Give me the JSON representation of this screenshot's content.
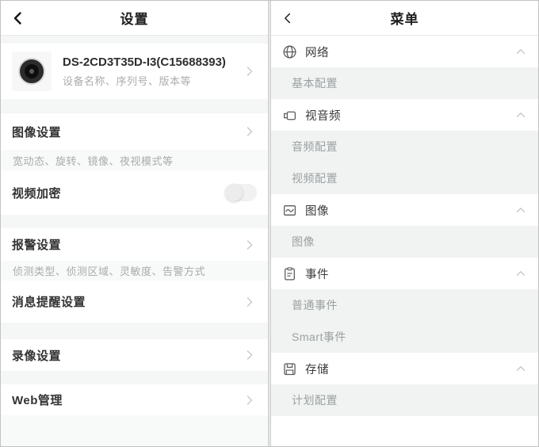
{
  "left": {
    "title": "设置",
    "device_name": "DS-2CD3T35D-I3(C15688393)",
    "device_desc": "设备名称、序列号、版本等",
    "items": [
      {
        "label": "图像设置",
        "desc": "宽动态、旋转、镜像、夜视模式等"
      },
      {
        "label": "视频加密",
        "toggle_state": "off"
      },
      {
        "label": "报警设置",
        "desc": "侦测类型、侦测区域、灵敏度、告警方式"
      },
      {
        "label": "消息提醒设置"
      },
      {
        "label": "录像设置"
      },
      {
        "label": "Web管理"
      }
    ]
  },
  "right": {
    "title": "菜单",
    "sections": [
      {
        "label": "网络",
        "icon": "globe-icon",
        "expanded": true,
        "children": [
          "基本配置"
        ]
      },
      {
        "label": "视音频",
        "icon": "camcorder-icon",
        "expanded": true,
        "children": [
          "音频配置",
          "视频配置"
        ]
      },
      {
        "label": "图像",
        "icon": "picture-icon",
        "expanded": true,
        "children": [
          "图像"
        ]
      },
      {
        "label": "事件",
        "icon": "clipboard-icon",
        "expanded": true,
        "children": [
          "普通事件",
          "Smart事件"
        ]
      },
      {
        "label": "存储",
        "icon": "floppy-icon",
        "expanded": true,
        "children": [
          "计划配置"
        ]
      }
    ]
  },
  "colors": {
    "title_text": "#333333",
    "muted_text": "#a9acac",
    "sub_item_text": "#9aa1a1",
    "band_bg_left": "#f8f9f9",
    "band_bg_right": "#f1f2f2",
    "chevron": "#c6c9c9",
    "divider": "#c9c9c9"
  }
}
